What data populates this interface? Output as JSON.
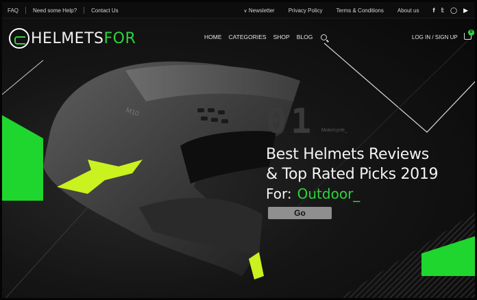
{
  "topbar": {
    "left": [
      "FAQ",
      "Need some Help?",
      "Contact Us"
    ],
    "right": [
      "Newsletter",
      "Privacy Policy",
      "Terms & Conditions",
      "About us"
    ],
    "social_icons": [
      "facebook-icon",
      "twitter-icon",
      "instagram-icon",
      "youtube-icon"
    ]
  },
  "brand": {
    "part1": "HELMETS",
    "part2": "FOR"
  },
  "nav": {
    "items": [
      "HOME",
      "CATEGORIES",
      "SHOP",
      "BLOG"
    ]
  },
  "auth": {
    "label": "LOG IN / SIGN UP"
  },
  "cart": {
    "count": "0"
  },
  "hero": {
    "number": "01",
    "category": "Motorcycle_",
    "headline_line1": "Best Helmets Reviews",
    "headline_line2": "& Top Rated Picks 2019",
    "for_label": "For:",
    "typed_word": "Outdoor_",
    "button_label": "Go"
  },
  "colors": {
    "accent": "#2bd63a",
    "background": "#151515",
    "button": "#8f8f8f"
  }
}
